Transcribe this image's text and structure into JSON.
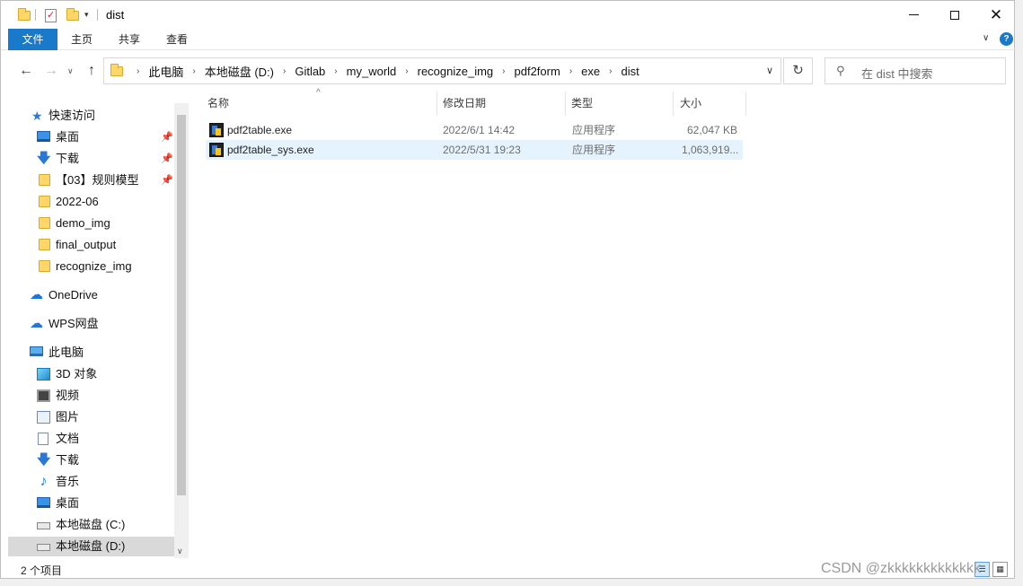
{
  "window": {
    "title": "dist",
    "controls": {
      "minimize_icon": "minimize-icon",
      "maximize_icon": "maximize-icon",
      "close_icon": "close-icon"
    }
  },
  "ribbon": {
    "tabs": [
      {
        "label": "文件"
      },
      {
        "label": "主页"
      },
      {
        "label": "共享"
      },
      {
        "label": "查看"
      }
    ]
  },
  "address": {
    "crumbs": [
      "此电脑",
      "本地磁盘 (D:)",
      "Gitlab",
      "my_world",
      "recognize_img",
      "pdf2form",
      "exe",
      "dist"
    ]
  },
  "search": {
    "placeholder": "在 dist 中搜索"
  },
  "sidebar": {
    "items": [
      {
        "label": "快速访问",
        "icon": "star-icon"
      },
      {
        "label": "桌面",
        "icon": "desktop-icon",
        "pinned": true
      },
      {
        "label": "下载",
        "icon": "download-icon",
        "pinned": true
      },
      {
        "label": "【03】规则模型",
        "icon": "folder-icon",
        "pinned": true
      },
      {
        "label": "2022-06",
        "icon": "folder-icon"
      },
      {
        "label": "demo_img",
        "icon": "folder-icon"
      },
      {
        "label": "final_output",
        "icon": "folder-icon"
      },
      {
        "label": "recognize_img",
        "icon": "folder-icon"
      },
      {
        "label": "OneDrive",
        "icon": "cloud-icon"
      },
      {
        "label": "WPS网盘",
        "icon": "wps-cloud-icon"
      },
      {
        "label": "此电脑",
        "icon": "computer-icon"
      },
      {
        "label": "3D 对象",
        "icon": "3d-objects-icon"
      },
      {
        "label": "视频",
        "icon": "video-icon"
      },
      {
        "label": "图片",
        "icon": "pictures-icon"
      },
      {
        "label": "文档",
        "icon": "documents-icon"
      },
      {
        "label": "下载",
        "icon": "download-icon"
      },
      {
        "label": "音乐",
        "icon": "music-icon"
      },
      {
        "label": "桌面",
        "icon": "desktop-icon"
      },
      {
        "label": "本地磁盘 (C:)",
        "icon": "drive-icon"
      },
      {
        "label": "本地磁盘 (D:)",
        "icon": "drive-icon",
        "selected": true
      }
    ]
  },
  "files": {
    "columns": [
      "名称",
      "修改日期",
      "类型",
      "大小"
    ],
    "rows": [
      {
        "name": "pdf2table.exe",
        "modified": "2022/6/1 14:42",
        "type": "应用程序",
        "size": "62,047 KB"
      },
      {
        "name": "pdf2table_sys.exe",
        "modified": "2022/5/31 19:23",
        "type": "应用程序",
        "size": "1,063,919...",
        "selected": true
      }
    ]
  },
  "status": {
    "item_count": "2 个项目"
  },
  "watermark": "CSDN @zkkkkkkkkkkkkk"
}
